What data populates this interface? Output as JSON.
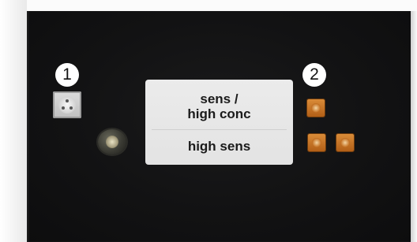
{
  "markers": {
    "one": "1",
    "two": "2"
  },
  "label": {
    "top": "sens /\nhigh conc",
    "bottom": "high sens"
  },
  "colors": {
    "panel": "#141415",
    "label_background": "#e6e6e6",
    "label_text": "#1b1b1b",
    "connector_copper": "#c97428"
  }
}
